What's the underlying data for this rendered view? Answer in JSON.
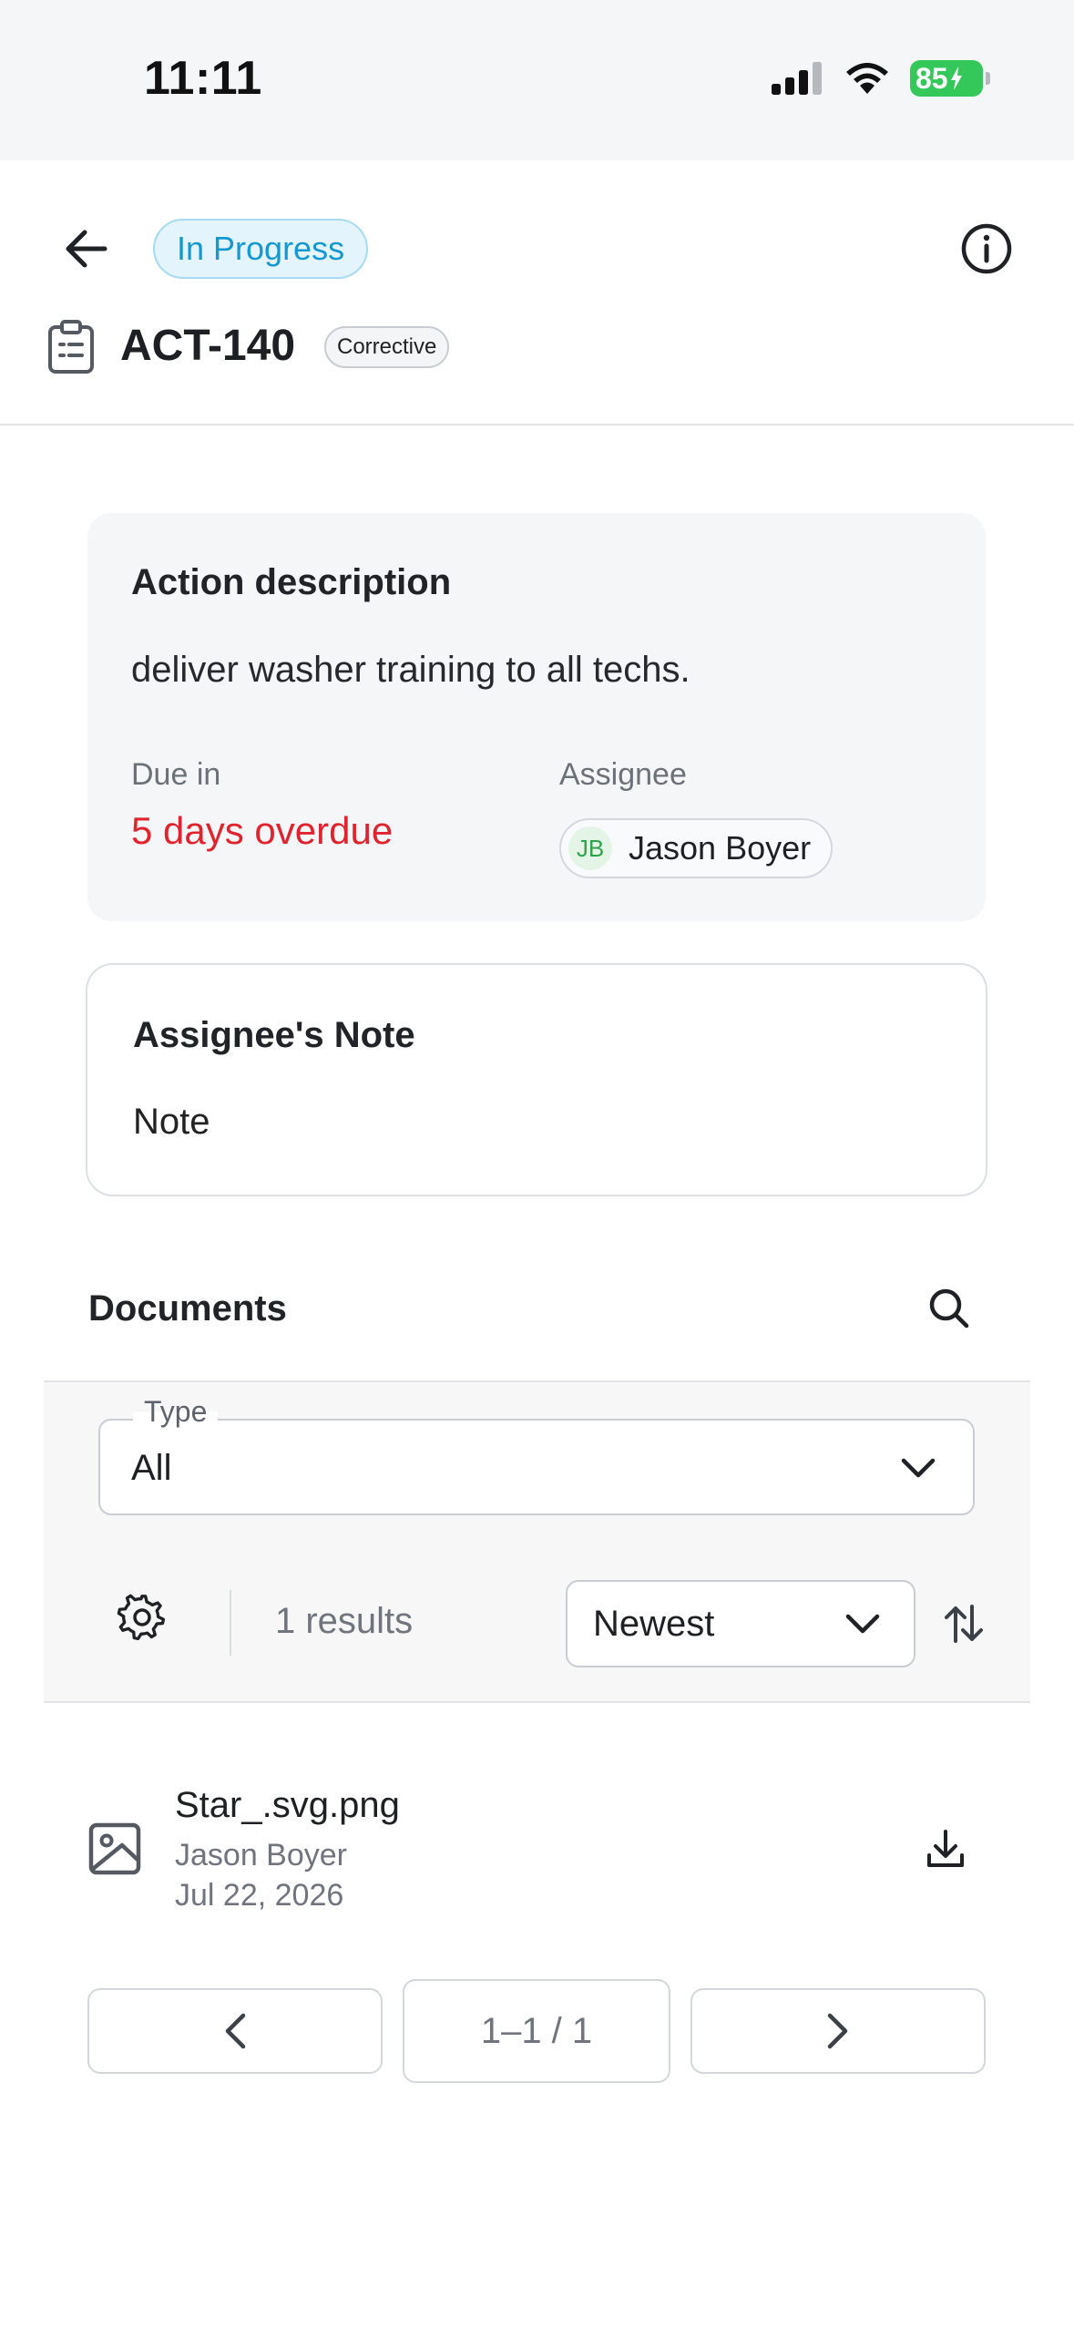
{
  "status_bar": {
    "time": "11:11",
    "battery": "85",
    "icons": [
      "signal-icon",
      "wifi-icon",
      "battery-charging-icon"
    ]
  },
  "header": {
    "status": "In Progress",
    "action_id": "ACT-140",
    "action_type": "Corrective",
    "icons": [
      "back-arrow-icon",
      "info-icon",
      "clipboard-icon"
    ]
  },
  "action_card": {
    "title": "Action description",
    "description": "deliver washer training to all techs.",
    "due_label": "Due in",
    "due_value": "5 days overdue",
    "assignee_label": "Assignee",
    "assignee_initials": "JB",
    "assignee_name": "Jason Boyer"
  },
  "note_card": {
    "title": "Assignee's Note",
    "text": "Note"
  },
  "documents": {
    "title": "Documents",
    "type_label": "Type",
    "type_value": "All",
    "results": "1 results",
    "sort_value": "Newest",
    "items": [
      {
        "name": "Star_.svg.png",
        "author": "Jason Boyer",
        "date": "Jul 22, 2026"
      }
    ],
    "pagination": "1–1 / 1"
  },
  "colors": {
    "status_pill_text": "#1597d0",
    "status_pill_bg": "#e3f4fc",
    "overdue": "#e0242f",
    "avatar_green": "#2ea34a",
    "battery_green": "#34c759"
  }
}
